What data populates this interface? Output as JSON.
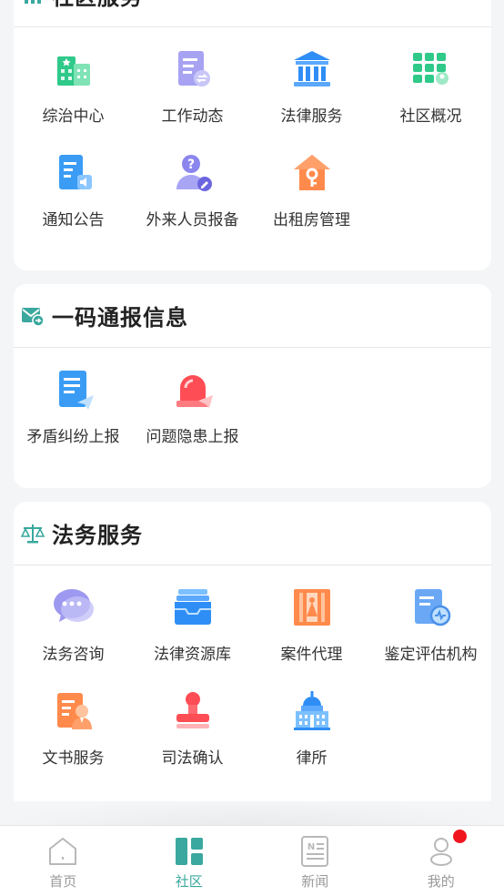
{
  "sections": {
    "community": {
      "title": "社区服务",
      "items": [
        {
          "label": "综治中心",
          "icon": "building-icon"
        },
        {
          "label": "工作动态",
          "icon": "document-sync-icon"
        },
        {
          "label": "法律服务",
          "icon": "courthouse-icon"
        },
        {
          "label": "社区概况",
          "icon": "grid-apps-icon"
        },
        {
          "label": "通知公告",
          "icon": "announcement-icon"
        },
        {
          "label": "外来人员报备",
          "icon": "user-question-icon"
        },
        {
          "label": "出租房管理",
          "icon": "house-key-icon"
        }
      ]
    },
    "report": {
      "title": "一码通报信息",
      "items": [
        {
          "label": "矛盾纠纷上报",
          "icon": "report-send-icon"
        },
        {
          "label": "问题隐患上报",
          "icon": "alarm-light-icon"
        }
      ]
    },
    "legal": {
      "title": "法务服务",
      "items": [
        {
          "label": "法务咨询",
          "icon": "chat-bubble-icon"
        },
        {
          "label": "法律资源库",
          "icon": "inbox-tray-icon"
        },
        {
          "label": "案件代理",
          "icon": "case-agent-icon"
        },
        {
          "label": "鉴定评估机构",
          "icon": "appraisal-icon"
        },
        {
          "label": "文书服务",
          "icon": "notary-document-icon"
        },
        {
          "label": "司法确认",
          "icon": "seal-stamp-icon"
        },
        {
          "label": "律所",
          "icon": "law-firm-building-icon"
        }
      ]
    }
  },
  "tabbar": [
    {
      "label": "首页",
      "icon": "home-icon",
      "active": false
    },
    {
      "label": "社区",
      "icon": "community-grid-icon",
      "active": true
    },
    {
      "label": "新闻",
      "icon": "news-icon",
      "active": false
    },
    {
      "label": "我的",
      "icon": "profile-icon",
      "active": false
    }
  ],
  "colors": {
    "accent": "#3aa89e",
    "badge": "#f0141e"
  }
}
